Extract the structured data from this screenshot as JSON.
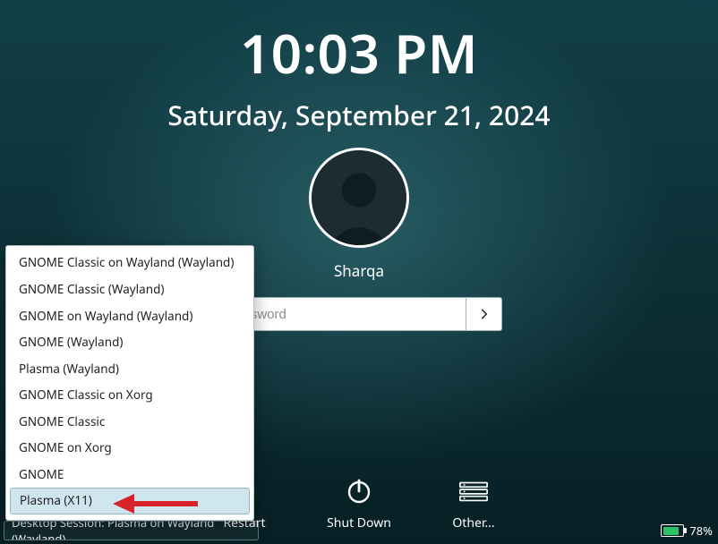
{
  "clock": {
    "time": "10:03 PM",
    "date": "Saturday, September 21, 2024"
  },
  "user": {
    "name": "Sharqa"
  },
  "password": {
    "placeholder": "Password"
  },
  "actions": {
    "restart": "Restart",
    "shutdown": "Shut Down",
    "other": "Other..."
  },
  "session_button": {
    "label": "Desktop Session: Plasma on Wayland (Wayland)"
  },
  "session_menu": {
    "items": [
      "GNOME Classic on Wayland (Wayland)",
      "GNOME Classic (Wayland)",
      "GNOME on Wayland (Wayland)",
      "GNOME (Wayland)",
      "Plasma (Wayland)",
      "GNOME Classic on Xorg",
      "GNOME Classic",
      "GNOME on Xorg",
      "GNOME"
    ],
    "selected": "Plasma (X11)"
  },
  "battery": {
    "percent": "78%",
    "level": 78
  }
}
